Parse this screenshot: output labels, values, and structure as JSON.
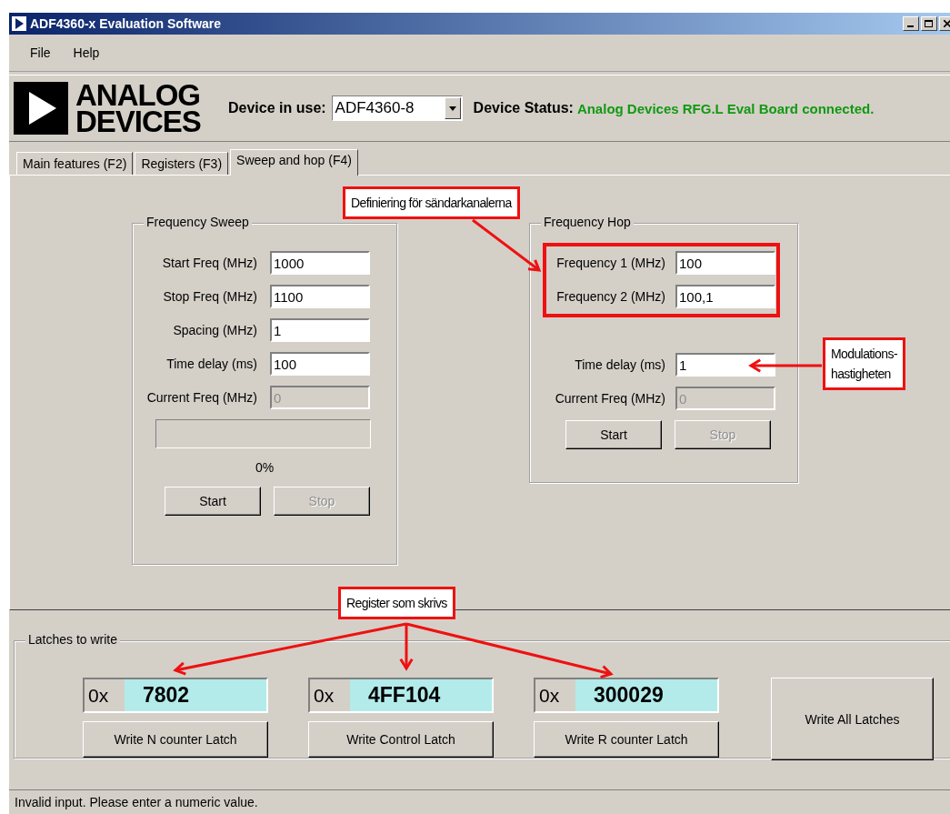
{
  "window": {
    "title": "ADF4360-x Evaluation Software"
  },
  "menu": [
    "File",
    "Help"
  ],
  "header": {
    "logo": [
      "ANALOG",
      "DEVICES"
    ],
    "device_label": "Device in use:",
    "device": "ADF4360-8",
    "status_label": "Device Status:",
    "status": "Analog Devices RFG.L Eval Board connected."
  },
  "tabs": [
    {
      "label": "Main features (F2)",
      "selected": false
    },
    {
      "label": "Registers (F3)",
      "selected": false
    },
    {
      "label": "Sweep and hop (F4)",
      "selected": true
    }
  ],
  "sweep": {
    "title": "Frequency Sweep",
    "fields": [
      {
        "label": "Start Freq (MHz)",
        "value": "1000",
        "disabled": false
      },
      {
        "label": "Stop Freq (MHz)",
        "value": "1100",
        "disabled": false
      },
      {
        "label": "Spacing (MHz)",
        "value": "1",
        "disabled": false
      },
      {
        "label": "Time delay (ms)",
        "value": "100",
        "disabled": false
      },
      {
        "label": "Current Freq (MHz)",
        "value": "0",
        "disabled": true
      }
    ],
    "level": 0,
    "percent": "0%",
    "buttons": [
      {
        "label": "Start",
        "disabled": false
      },
      {
        "label": "Stop",
        "disabled": true
      }
    ]
  },
  "hop": {
    "title": "Frequency Hop",
    "channel_fields": [
      {
        "label": "Frequency 1 (MHz)",
        "value": "100",
        "disabled": false
      },
      {
        "label": "Frequency 2 (MHz)",
        "value": "100,1",
        "disabled": false
      }
    ],
    "fields": [
      {
        "label": "Time delay (ms)",
        "value": "1",
        "disabled": false
      },
      {
        "label": "Current Freq (MHz)",
        "value": "0",
        "disabled": true
      }
    ],
    "buttons": [
      {
        "label": "Start",
        "disabled": false
      },
      {
        "label": "Stop",
        "disabled": true
      }
    ]
  },
  "latches": {
    "title": "Latches to write",
    "items": [
      {
        "prefix": "0x",
        "value": "7802",
        "button": "Write N counter Latch"
      },
      {
        "prefix": "0x",
        "value": "4FF104",
        "button": "Write Control Latch"
      },
      {
        "prefix": "0x",
        "value": "300029",
        "button": "Write R counter Latch"
      }
    ],
    "write_all": "Write All Latches"
  },
  "annotations": [
    {
      "lines": [
        "Definiering för sändarkanalerna"
      ]
    },
    {
      "lines": [
        "Modulations-",
        "hastigheten"
      ]
    },
    {
      "lines": [
        "Register som skrivs"
      ]
    }
  ],
  "status_bar": "Invalid input. Please enter a numeric value."
}
